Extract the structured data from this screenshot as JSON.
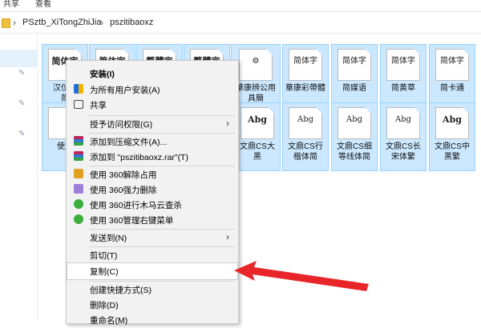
{
  "ribbon": {
    "tab_share": "共享",
    "tab_view": "查看"
  },
  "address": {
    "crumb1": "PSztb_XiTongZhiJia",
    "crumb2": "pszitibaoxz",
    "separator": "›"
  },
  "row1": [
    {
      "preview": "简体字",
      "label": "汉仪菱\n简"
    },
    {
      "preview": "简体字",
      "label": ""
    },
    {
      "preview": "繁體字",
      "label": ""
    },
    {
      "preview": "繁體字",
      "label": ""
    },
    {
      "preview": "",
      "label": "華康辨公用\n具簡"
    },
    {
      "preview": "简体字",
      "label": "華康彩帶體"
    },
    {
      "preview": "简体字",
      "label": "简媒语"
    },
    {
      "preview": "简体字",
      "label": "简黄草"
    },
    {
      "preview": "简体字",
      "label": "简卡通"
    }
  ],
  "row2": [
    {
      "preview": "",
      "label": "使用"
    },
    {
      "preview": "Abg",
      "label": "文鼎CS大\n黑"
    },
    {
      "preview": "Abg",
      "label": "文鼎CS行\n楷体简"
    },
    {
      "preview": "Abg",
      "label": "文鼎CS细\n等线体简"
    },
    {
      "preview": "Abg",
      "label": "文鼎CS长\n宋体繁"
    },
    {
      "preview": "Abg",
      "label": "文鼎CS中\n黑繁"
    }
  ],
  "menu": {
    "install": "安装(I)",
    "install_all": "为所有用户安装(A)",
    "share": "共享",
    "grant_access": "授予访问权限(G)",
    "add_archive": "添加到压缩文件(A)...",
    "add_rar": "添加到 \"pszitibaoxz.rar\"(T)",
    "unlock_360": "使用 360解除占用",
    "force_delete_360": "使用 360强力删除",
    "scan_360": "使用 360进行木马云查杀",
    "manage_360": "使用 360管理右键菜单",
    "send_to": "发送到(N)",
    "cut": "剪切(T)",
    "copy": "复制(C)",
    "create_shortcut": "创建快捷方式(S)",
    "delete": "删除(D)",
    "rename": "重命名(M)"
  },
  "colors": {
    "selection": "#cce8ff",
    "arrow": "#e8262a",
    "menu_bg": "#f2f2f2"
  },
  "icons": {
    "pin": "pin-icon",
    "submenu": "chevron-right-icon"
  }
}
